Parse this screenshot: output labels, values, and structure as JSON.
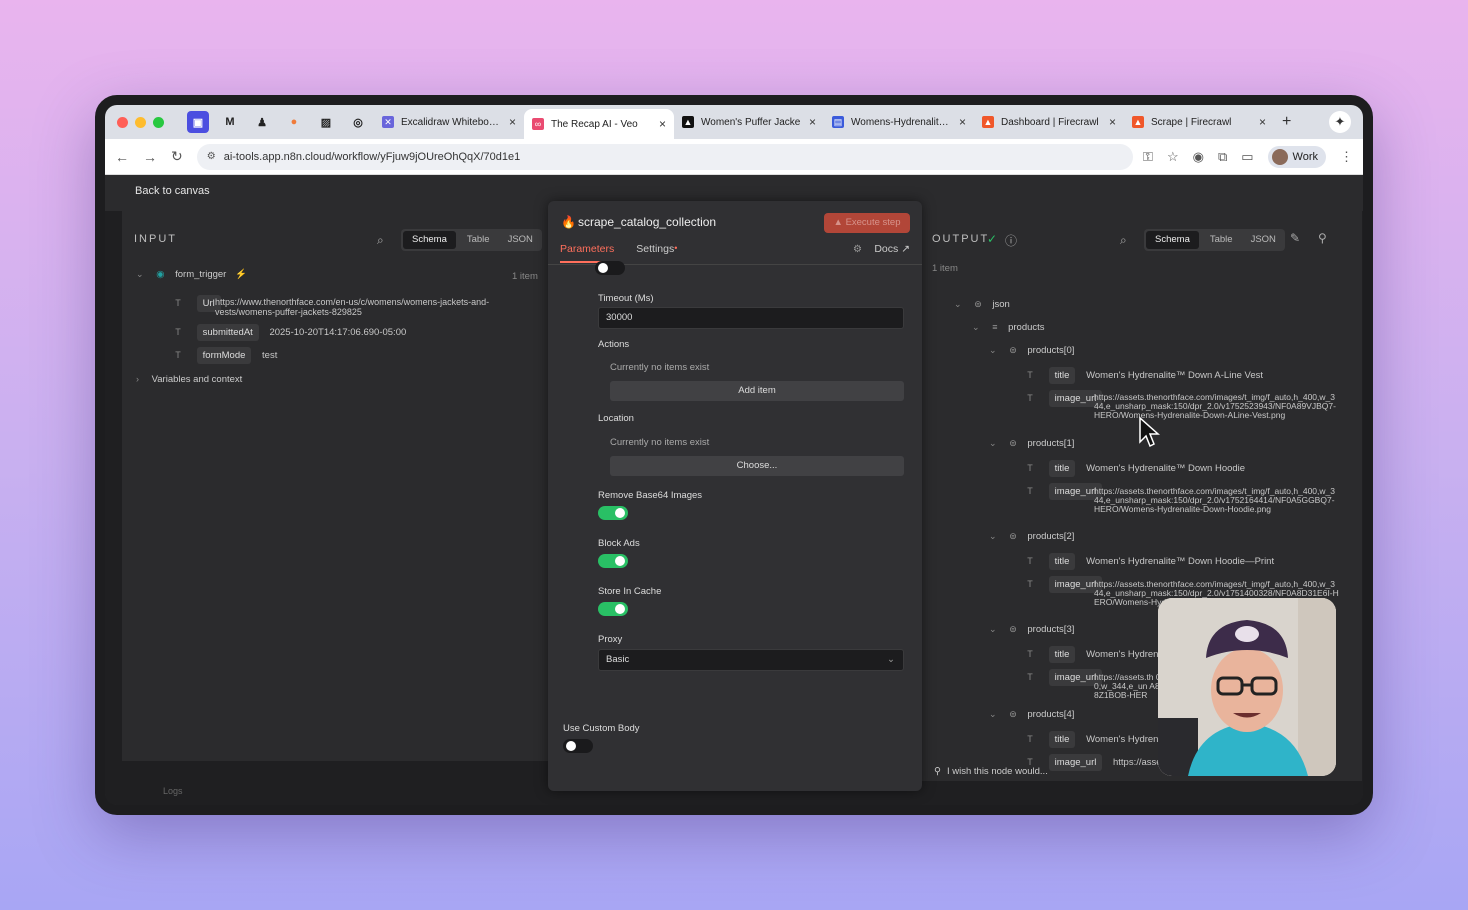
{
  "browser": {
    "tabs": [
      {
        "label": "Excalidraw Whiteboard",
        "favicon_color": "#6965db"
      },
      {
        "label": "The Recap AI - Veo",
        "favicon_color": "#ea4b71"
      },
      {
        "label": "Women's Puffer Jacke",
        "favicon_color": "#111111"
      },
      {
        "label": "Womens-Hydrenalite-D",
        "favicon_color": "#3b5bdb"
      },
      {
        "label": "Dashboard | Firecrawl",
        "favicon_color": "#f0572a"
      },
      {
        "label": "Scrape | Firecrawl",
        "favicon_color": "#f0572a"
      }
    ],
    "url": "ai-tools.app.n8n.cloud/workflow/yFjuw9jOUreOhQqX/70d1e1",
    "profile_label": "Work"
  },
  "app": {
    "back_label": "Back to canvas",
    "logs_label": "Logs",
    "wish_label": "I wish this node would..."
  },
  "input": {
    "label": "INPUT",
    "views": [
      "Schema",
      "Table",
      "JSON"
    ],
    "node_name": "form_trigger",
    "count": "1 item",
    "fields": [
      {
        "key": "Url",
        "value": "https://www.thenorthface.com/en-us/c/womens/womens-jackets-and-vests/womens-puffer-jackets-829825"
      },
      {
        "key": "submittedAt",
        "value": "2025-10-20T14:17:06.690-05:00"
      },
      {
        "key": "formMode",
        "value": "test"
      }
    ],
    "vars_label": "Variables and context"
  },
  "params": {
    "node_title": "scrape_catalog_collection",
    "execute_label": "Execute step",
    "tabs": {
      "parameters": "Parameters",
      "settings": "Settings"
    },
    "docs_label": "Docs",
    "timeout_label": "Timeout (Ms)",
    "timeout_value": "30000",
    "actions_label": "Actions",
    "actions_empty": "Currently no items exist",
    "add_item_label": "Add item",
    "location_label": "Location",
    "location_empty": "Currently no items exist",
    "choose_label": "Choose...",
    "remove_base64_label": "Remove Base64 Images",
    "block_ads_label": "Block Ads",
    "store_cache_label": "Store In Cache",
    "proxy_label": "Proxy",
    "proxy_value": "Basic",
    "custom_body_label": "Use Custom Body"
  },
  "output": {
    "label": "OUTPUT",
    "views": [
      "Schema",
      "Table",
      "JSON"
    ],
    "count": "1 item",
    "root": "json",
    "array": "products",
    "items": [
      {
        "name": "products[0]",
        "title": "Women's Hydrenalite™ Down A-Line Vest",
        "image_url": "https://assets.thenorthface.com/images/t_img/f_auto,h_400,w_344,e_unsharp_mask:150/dpr_2.0/v1752523943/NF0A89VJBQ7-HERO/Womens-Hydrenalite-Down-ALine-Vest.png"
      },
      {
        "name": "products[1]",
        "title": "Women's Hydrenalite™ Down Hoodie",
        "image_url": "https://assets.thenorthface.com/images/t_img/f_auto,h_400,w_344,e_unsharp_mask:150/dpr_2.0/v1752164414/NF0A5GGBQ7-HERO/Womens-Hydrenalite-Down-Hoodie.png"
      },
      {
        "name": "products[2]",
        "title": "Women's Hydrenalite™ Down Hoodie—Print",
        "image_url": "https://assets.thenorthface.com/images/t_img/f_auto,h_400,w_344,e_unsharp_mask:150/dpr_2.0/v1751400328/NF0A8D31E6I-HERO/Womens-Hydrenalite-Down-HoodiePrint.png"
      },
      {
        "name": "products[3]",
        "title": "Women's Hydrenalite",
        "image_url": "https://assets.th 00,w_344,e_un A88Z1BOB-HER"
      },
      {
        "name": "products[4]",
        "title": "Women's Hydrenalite",
        "image_url": "https://assets.th"
      }
    ],
    "key_title": "title",
    "key_image": "image_url"
  }
}
